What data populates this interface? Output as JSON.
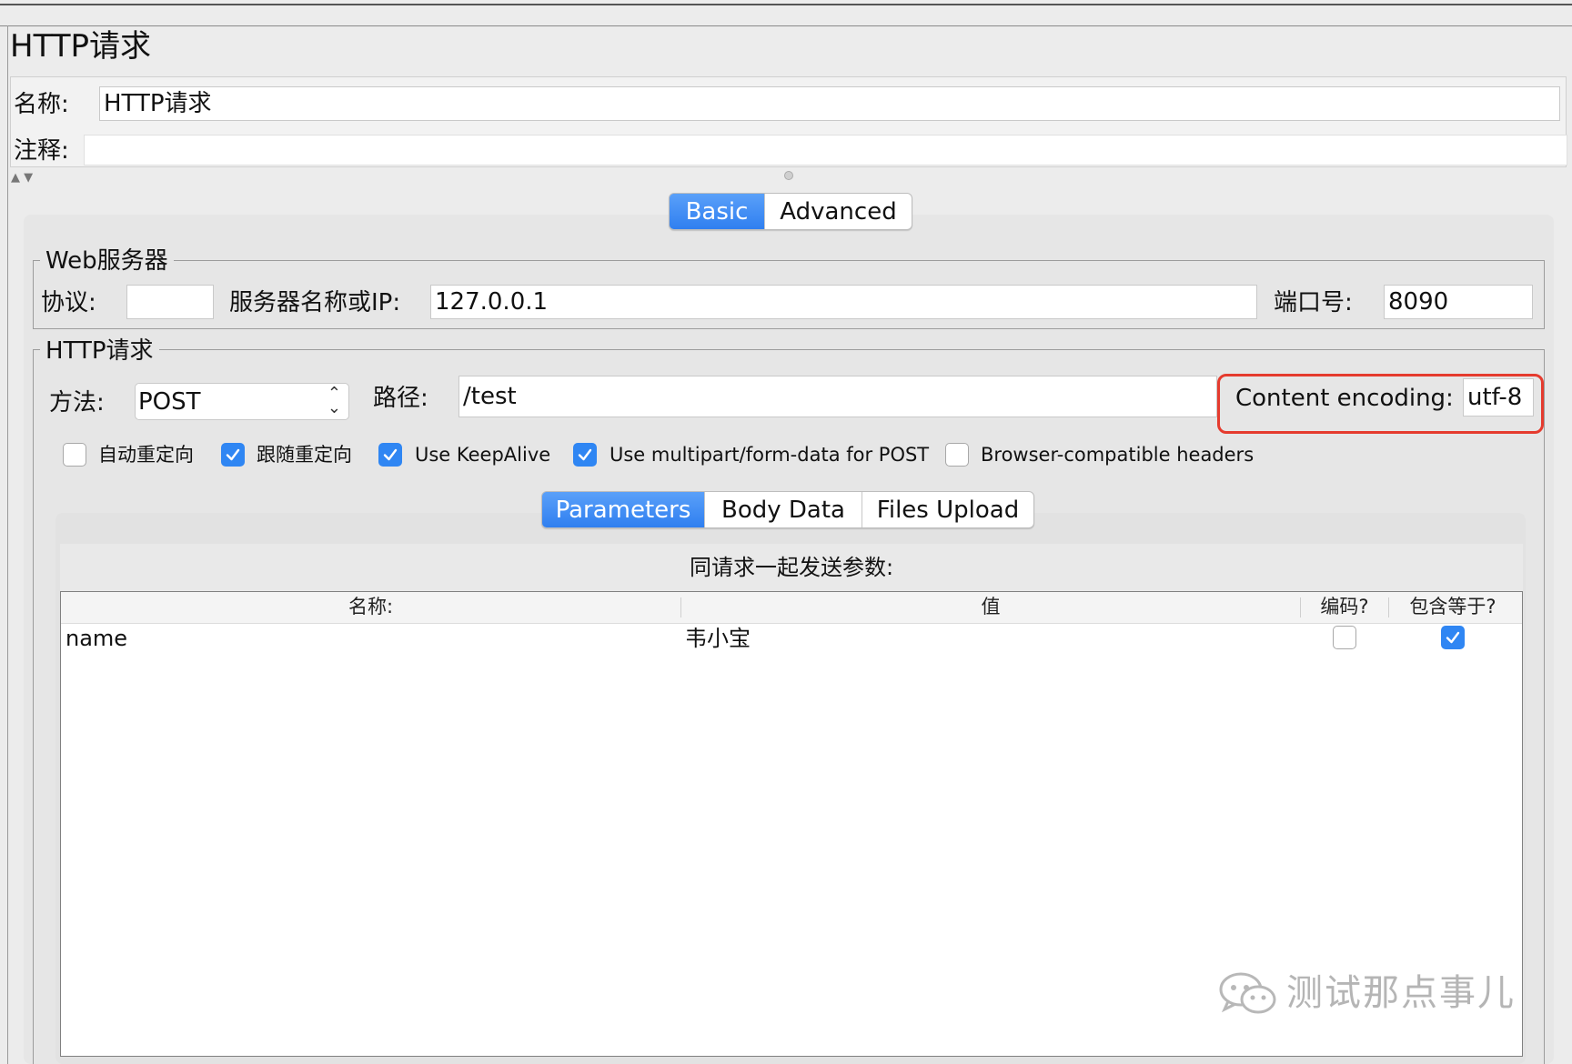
{
  "window": {
    "title": "HTTP请求"
  },
  "name_field": {
    "label": "名称:",
    "value": "HTTP请求"
  },
  "comment_field": {
    "label": "注释:",
    "value": ""
  },
  "main_tabs": [
    {
      "label": "Basic",
      "active": true
    },
    {
      "label": "Advanced",
      "active": false
    }
  ],
  "web_server": {
    "legend": "Web服务器",
    "protocol_label": "协议:",
    "protocol_value": "",
    "server_label": "服务器名称或IP:",
    "server_value": "127.0.0.1",
    "port_label": "端口号:",
    "port_value": "8090"
  },
  "http_request": {
    "legend": "HTTP请求",
    "method_label": "方法:",
    "method_value": "POST",
    "path_label": "路径:",
    "path_value": "/test",
    "encoding_label": "Content encoding:",
    "encoding_value": "utf-8"
  },
  "options": [
    {
      "label": "自动重定向",
      "checked": false
    },
    {
      "label": "跟随重定向",
      "checked": true
    },
    {
      "label": "Use KeepAlive",
      "checked": true
    },
    {
      "label": "Use multipart/form-data for POST",
      "checked": true
    },
    {
      "label": "Browser-compatible headers",
      "checked": false
    }
  ],
  "sub_tabs": [
    {
      "label": "Parameters",
      "active": true
    },
    {
      "label": "Body Data",
      "active": false
    },
    {
      "label": "Files Upload",
      "active": false
    }
  ],
  "params": {
    "caption": "同请求一起发送参数:",
    "columns": [
      "名称:",
      "值",
      "编码?",
      "包含等于?"
    ],
    "rows": [
      {
        "name": "name",
        "value": "韦小宝",
        "encode": false,
        "include_equals": true
      }
    ]
  },
  "watermark": {
    "text": "测试那点事儿"
  },
  "colors": {
    "accent": "#2f86f3",
    "highlight": "#e53b2e"
  }
}
